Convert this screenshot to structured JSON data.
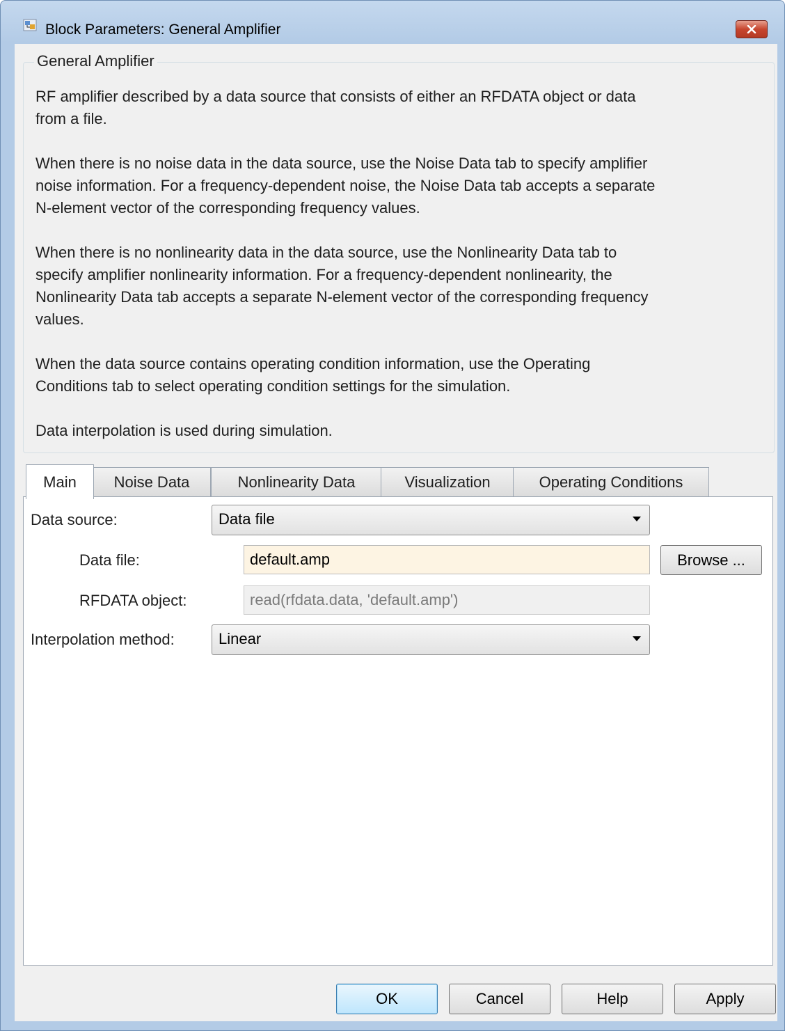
{
  "window": {
    "title": "Block Parameters: General Amplifier"
  },
  "group": {
    "title": "General Amplifier",
    "paragraphs": [
      [
        "RF amplifier described by a data source that consists of either an RFDATA object or data",
        "from a file."
      ],
      [
        "When there is no noise data in the data source, use the Noise Data tab to specify amplifier",
        "noise information. For a frequency-dependent noise, the Noise Data tab accepts a separate",
        "N-element vector of the corresponding frequency values."
      ],
      [
        "When there is no nonlinearity data in the data source, use the Nonlinearity Data tab to",
        "specify amplifier nonlinearity information. For a frequency-dependent nonlinearity, the",
        "Nonlinearity Data tab accepts a separate N-element vector of the corresponding frequency",
        "values."
      ],
      [
        "When the data source contains operating condition information, use the Operating",
        "Conditions tab to select operating condition settings for the simulation."
      ],
      [
        "Data interpolation is used during simulation."
      ]
    ]
  },
  "tabs": [
    "Main",
    "Noise Data",
    "Nonlinearity Data",
    "Visualization",
    "Operating Conditions"
  ],
  "active_tab": "Main",
  "main": {
    "data_source_label": "Data source:",
    "data_source_value": "Data file",
    "data_file_label": "Data file:",
    "data_file_value": "default.amp",
    "browse_label": "Browse ...",
    "rfdata_label": "RFDATA object:",
    "rfdata_value": "read(rfdata.data, 'default.amp')",
    "interp_label": "Interpolation method:",
    "interp_value": "Linear"
  },
  "buttons": {
    "ok": "OK",
    "cancel": "Cancel",
    "help": "Help",
    "apply": "Apply"
  },
  "colors": {
    "titlebar": "#b3cbe6",
    "close": "#c7462f",
    "dialog_bg": "#f0f0f0",
    "input_highlight": "#fdf4e3"
  }
}
